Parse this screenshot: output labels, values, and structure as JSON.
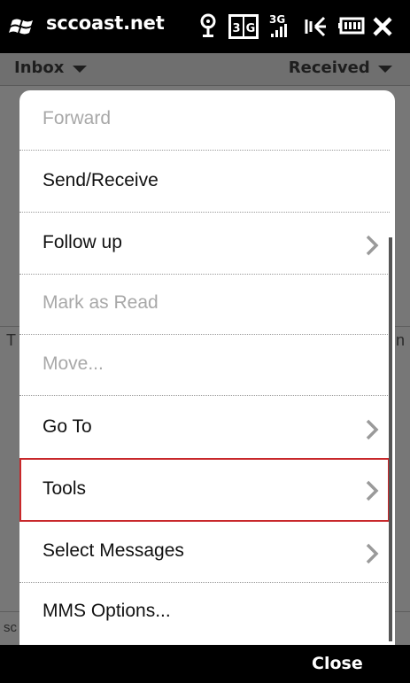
{
  "titlebar": {
    "title": "sccoast.net",
    "icons": [
      "windows-start-icon",
      "antenna-icon",
      "data-connection-icon",
      "3g-signal-icon",
      "speaker-vibrate-icon",
      "battery-icon",
      "close-icon"
    ]
  },
  "background": {
    "folder": "Inbox",
    "sort": "Received",
    "fragment_left": "T",
    "fragment_right": "n",
    "fragment_bottom": "sc"
  },
  "menu": {
    "items": [
      {
        "label": "Forward",
        "enabled": false,
        "submenu": false
      },
      {
        "label": "Send/Receive",
        "enabled": true,
        "submenu": false
      },
      {
        "label": "Follow up",
        "enabled": true,
        "submenu": true
      },
      {
        "label": "Mark as Read",
        "enabled": false,
        "submenu": false
      },
      {
        "label": "Move...",
        "enabled": false,
        "submenu": false
      },
      {
        "label": "Go To",
        "enabled": true,
        "submenu": true
      },
      {
        "label": "Tools",
        "enabled": true,
        "submenu": true,
        "selected": true
      },
      {
        "label": "Select Messages",
        "enabled": true,
        "submenu": true
      },
      {
        "label": "MMS Options...",
        "enabled": true,
        "submenu": false
      }
    ]
  },
  "softkeys": {
    "right": "Close"
  },
  "colors": {
    "selection_outline": "#c8282b",
    "titlebar_bg": "#000000",
    "menu_bg": "#ffffff",
    "disabled_text": "#a8a8a8"
  }
}
